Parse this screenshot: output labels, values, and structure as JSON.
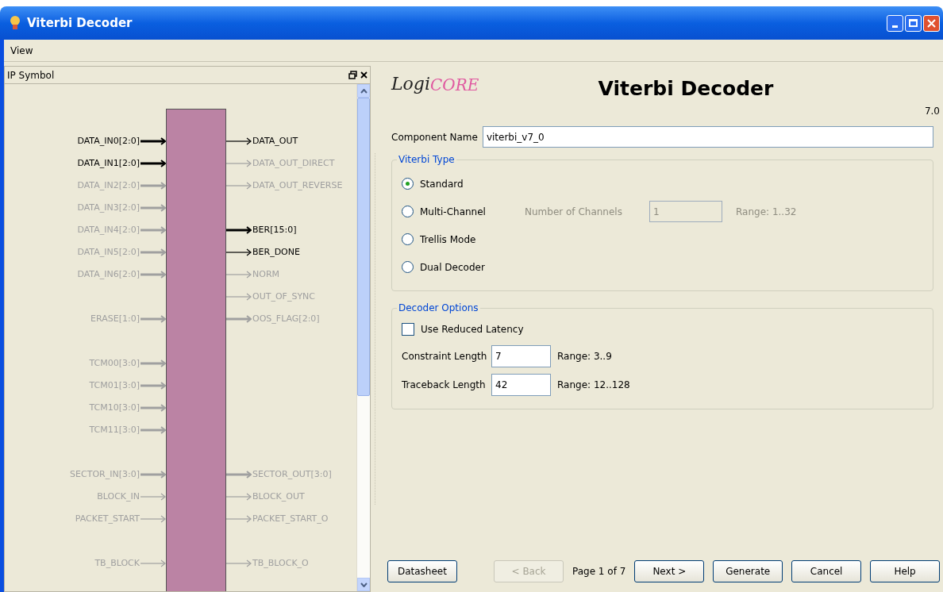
{
  "window": {
    "title": "Viterbi Decoder"
  },
  "menu": [
    {
      "label": "View"
    }
  ],
  "symbol_panel": {
    "title": "IP Symbol",
    "pin_groups": [
      [
        {
          "left": {
            "name": "DATA_IN0[2:0]",
            "active": true,
            "bus": true
          },
          "right": {
            "name": "DATA_OUT",
            "active": true,
            "bus": false
          }
        },
        {
          "left": {
            "name": "DATA_IN1[2:0]",
            "active": true,
            "bus": true
          },
          "right": {
            "name": "DATA_OUT_DIRECT",
            "active": false,
            "bus": false
          }
        },
        {
          "left": {
            "name": "DATA_IN2[2:0]",
            "active": false,
            "bus": true
          },
          "right": {
            "name": "DATA_OUT_REVERSE",
            "active": false,
            "bus": false
          }
        },
        {
          "left": {
            "name": "DATA_IN3[2:0]",
            "active": false,
            "bus": true
          }
        },
        {
          "left": {
            "name": "DATA_IN4[2:0]",
            "active": false,
            "bus": true
          },
          "right": {
            "name": "BER[15:0]",
            "active": true,
            "bus": true
          }
        },
        {
          "left": {
            "name": "DATA_IN5[2:0]",
            "active": false,
            "bus": true
          },
          "right": {
            "name": "BER_DONE",
            "active": true,
            "bus": false
          }
        },
        {
          "left": {
            "name": "DATA_IN6[2:0]",
            "active": false,
            "bus": true
          },
          "right": {
            "name": "NORM",
            "active": false,
            "bus": false
          }
        },
        {
          "right": {
            "name": "OUT_OF_SYNC",
            "active": false,
            "bus": false
          }
        },
        {
          "left": {
            "name": "ERASE[1:0]",
            "active": false,
            "bus": true
          },
          "right": {
            "name": "OOS_FLAG[2:0]",
            "active": false,
            "bus": true
          }
        }
      ],
      [
        {
          "left": {
            "name": "TCM00[3:0]",
            "active": false,
            "bus": true
          }
        },
        {
          "left": {
            "name": "TCM01[3:0]",
            "active": false,
            "bus": true
          }
        },
        {
          "left": {
            "name": "TCM10[3:0]",
            "active": false,
            "bus": true
          }
        },
        {
          "left": {
            "name": "TCM11[3:0]",
            "active": false,
            "bus": true
          }
        }
      ],
      [
        {
          "left": {
            "name": "SECTOR_IN[3:0]",
            "active": false,
            "bus": true
          },
          "right": {
            "name": "SECTOR_OUT[3:0]",
            "active": false,
            "bus": true
          }
        },
        {
          "left": {
            "name": "BLOCK_IN",
            "active": false,
            "bus": false
          },
          "right": {
            "name": "BLOCK_OUT",
            "active": false,
            "bus": false
          }
        },
        {
          "left": {
            "name": "PACKET_START",
            "active": false,
            "bus": false
          },
          "right": {
            "name": "PACKET_START_O",
            "active": false,
            "bus": false
          }
        }
      ],
      [
        {
          "left": {
            "name": "TB_BLOCK",
            "active": false,
            "bus": false
          },
          "right": {
            "name": "TB_BLOCK_O",
            "active": false,
            "bus": false
          }
        }
      ]
    ]
  },
  "header": {
    "logo": [
      "Logi",
      "CORE"
    ],
    "title": "Viterbi Decoder",
    "version": "7.0"
  },
  "component_name": {
    "label": "Component Name",
    "value": "viterbi_v7_0"
  },
  "viterbi_type": {
    "title": "Viterbi Type",
    "options": [
      {
        "label": "Standard",
        "selected": true
      },
      {
        "label": "Multi-Channel",
        "selected": false,
        "extra": {
          "label": "Number of Channels",
          "value": "1",
          "range": "Range: 1..32",
          "disabled": true
        }
      },
      {
        "label": "Trellis Mode",
        "selected": false
      },
      {
        "label": "Dual Decoder",
        "selected": false
      }
    ]
  },
  "decoder_options": {
    "title": "Decoder Options",
    "checkbox": {
      "label": "Use Reduced Latency",
      "checked": false
    },
    "fields": [
      {
        "label": "Constraint Length",
        "value": "7",
        "range": "Range: 3..9"
      },
      {
        "label": "Traceback Length",
        "value": "42",
        "range": "Range: 12..128"
      }
    ]
  },
  "footer": {
    "left_buttons": [
      {
        "label": "Datasheet",
        "disabled": false
      }
    ],
    "back_button": {
      "label": "< Back",
      "disabled": true
    },
    "page": "Page 1 of 7",
    "right_buttons": [
      {
        "label": "Next >",
        "disabled": false
      },
      {
        "label": "Generate",
        "disabled": false
      },
      {
        "label": "Cancel",
        "disabled": false
      },
      {
        "label": "Help",
        "disabled": false
      }
    ]
  }
}
